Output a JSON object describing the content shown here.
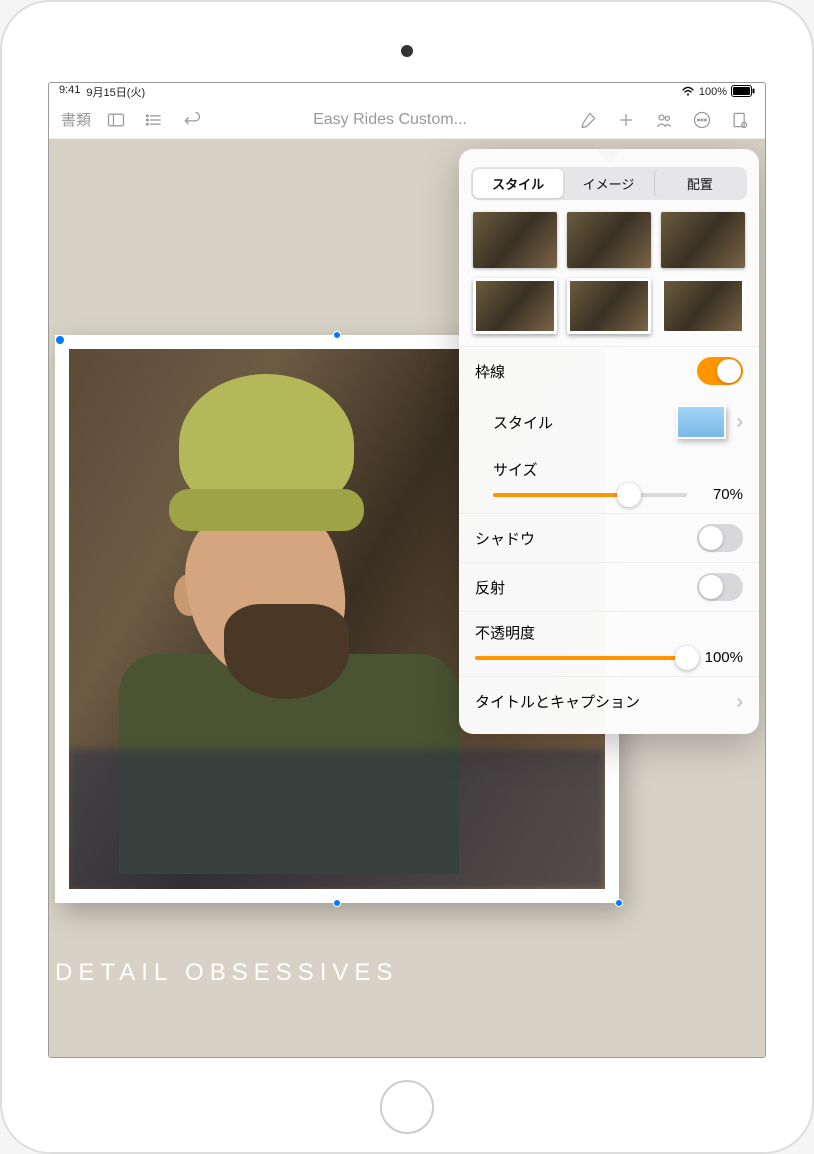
{
  "status": {
    "time": "9:41",
    "date": "9月15日(火)",
    "battery_pct": "100%"
  },
  "toolbar": {
    "documents_label": "書類",
    "doc_title": "Easy Rides Custom..."
  },
  "canvas": {
    "caption_text": "DETAIL OBSESSIVES"
  },
  "popover": {
    "tabs": {
      "style": "スタイル",
      "image": "イメージ",
      "arrange": "配置"
    },
    "border": {
      "label": "枠線",
      "enabled": true,
      "style_label": "スタイル",
      "size_label": "サイズ",
      "size_value": "70%",
      "size_pct": 70
    },
    "shadow": {
      "label": "シャドウ",
      "enabled": false
    },
    "reflection": {
      "label": "反射",
      "enabled": false
    },
    "opacity": {
      "label": "不透明度",
      "value": "100%",
      "pct": 100
    },
    "title_caption": {
      "label": "タイトルとキャプション"
    }
  }
}
